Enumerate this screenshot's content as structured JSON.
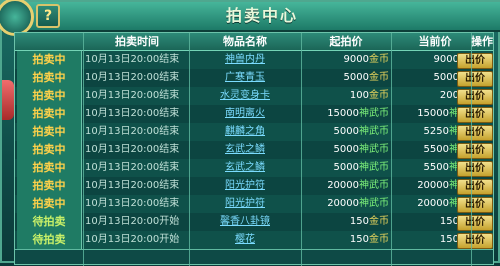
{
  "window": {
    "title": "拍卖中心",
    "help_label": "?"
  },
  "table": {
    "headers": [
      "拍卖时间",
      "物品名称",
      "起拍价",
      "当前价",
      "操作"
    ],
    "rows": [
      {
        "status": "拍卖中",
        "time": "10月13日20:00结束",
        "item": "神兽内丹",
        "start": "9000",
        "start_unit": "金币",
        "current": "9000",
        "current_unit": "金币",
        "action": "出价"
      },
      {
        "status": "拍卖中",
        "time": "10月13日20:00结束",
        "item": "广寒青玉",
        "start": "5000",
        "start_unit": "金币",
        "current": "5000",
        "current_unit": "金币",
        "action": "出价"
      },
      {
        "status": "拍卖中",
        "time": "10月13日20:00结束",
        "item": "水灵变身卡",
        "start": "100",
        "start_unit": "金币",
        "current": "200",
        "current_unit": "金币",
        "action": "出价"
      },
      {
        "status": "拍卖中",
        "time": "10月13日20:00结束",
        "item": "南明离火",
        "start": "15000",
        "start_unit": "神武币",
        "current": "15000",
        "current_unit": "神武币",
        "action": "出价"
      },
      {
        "status": "拍卖中",
        "time": "10月13日20:00结束",
        "item": "麒麟之角",
        "start": "5000",
        "start_unit": "神武币",
        "current": "5250",
        "current_unit": "神武币",
        "action": "出价"
      },
      {
        "status": "拍卖中",
        "time": "10月13日20:00结束",
        "item": "玄武之鳞",
        "start": "5000",
        "start_unit": "神武币",
        "current": "5500",
        "current_unit": "神武币",
        "action": "出价"
      },
      {
        "status": "拍卖中",
        "time": "10月13日20:00结束",
        "item": "玄武之鳞",
        "start": "5000",
        "start_unit": "神武币",
        "current": "5500",
        "current_unit": "神武币",
        "action": "出价"
      },
      {
        "status": "拍卖中",
        "time": "10月13日20:00结束",
        "item": "阳光护符",
        "start": "20000",
        "start_unit": "神武币",
        "current": "20000",
        "current_unit": "神武币",
        "action": "出价"
      },
      {
        "status": "拍卖中",
        "time": "10月13日20:00结束",
        "item": "阳光护符",
        "start": "20000",
        "start_unit": "神武币",
        "current": "20000",
        "current_unit": "神武币",
        "action": "出价"
      },
      {
        "status": "待拍卖",
        "time": "10月13日20:00开始",
        "item": "馨香八卦镜",
        "start": "150",
        "start_unit": "金币",
        "current": "150",
        "current_unit": "金币",
        "action": "出价"
      },
      {
        "status": "待拍卖",
        "time": "10月13日20:00开始",
        "item": "樱花",
        "start": "150",
        "start_unit": "金币",
        "current": "150",
        "current_unit": "金币",
        "action": "出价"
      }
    ]
  },
  "colors": {
    "gold_unit": "#e7d45c",
    "god_unit": "#7ef27a",
    "item_link": "#7bdcff",
    "status_auction": "#ffd24a",
    "status_waiting": "#c8f068"
  }
}
